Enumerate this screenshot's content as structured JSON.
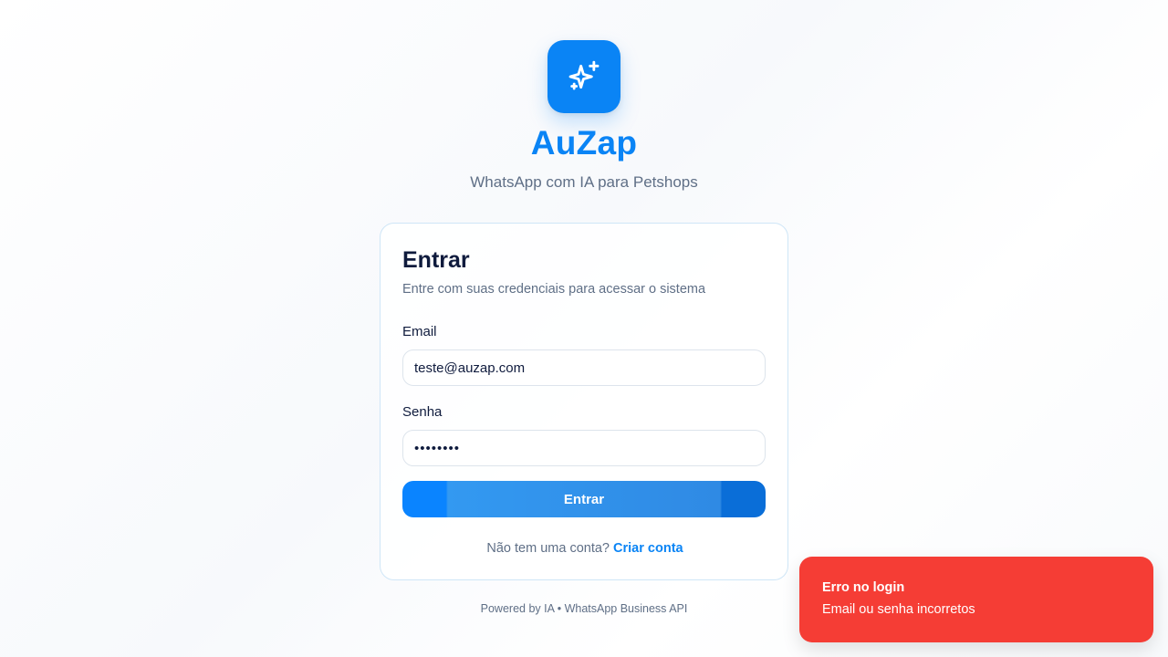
{
  "app": {
    "name": "AuZap",
    "tagline": "WhatsApp com IA para Petshops",
    "logo_icon": "sparkles-icon",
    "accent": "#0a84f5"
  },
  "login": {
    "title": "Entrar",
    "subtitle": "Entre com suas credenciais para acessar o sistema",
    "email_label": "Email",
    "email_value": "teste@auzap.com",
    "password_label": "Senha",
    "password_value": "••••••••",
    "submit_label": "Entrar",
    "signup_prompt": "Não tem uma conta?",
    "signup_link": "Criar conta"
  },
  "footer": {
    "text": "Powered by IA • WhatsApp Business API"
  },
  "toast": {
    "title": "Erro no login",
    "message": "Email ou senha incorretos",
    "color": "#f53d35"
  }
}
